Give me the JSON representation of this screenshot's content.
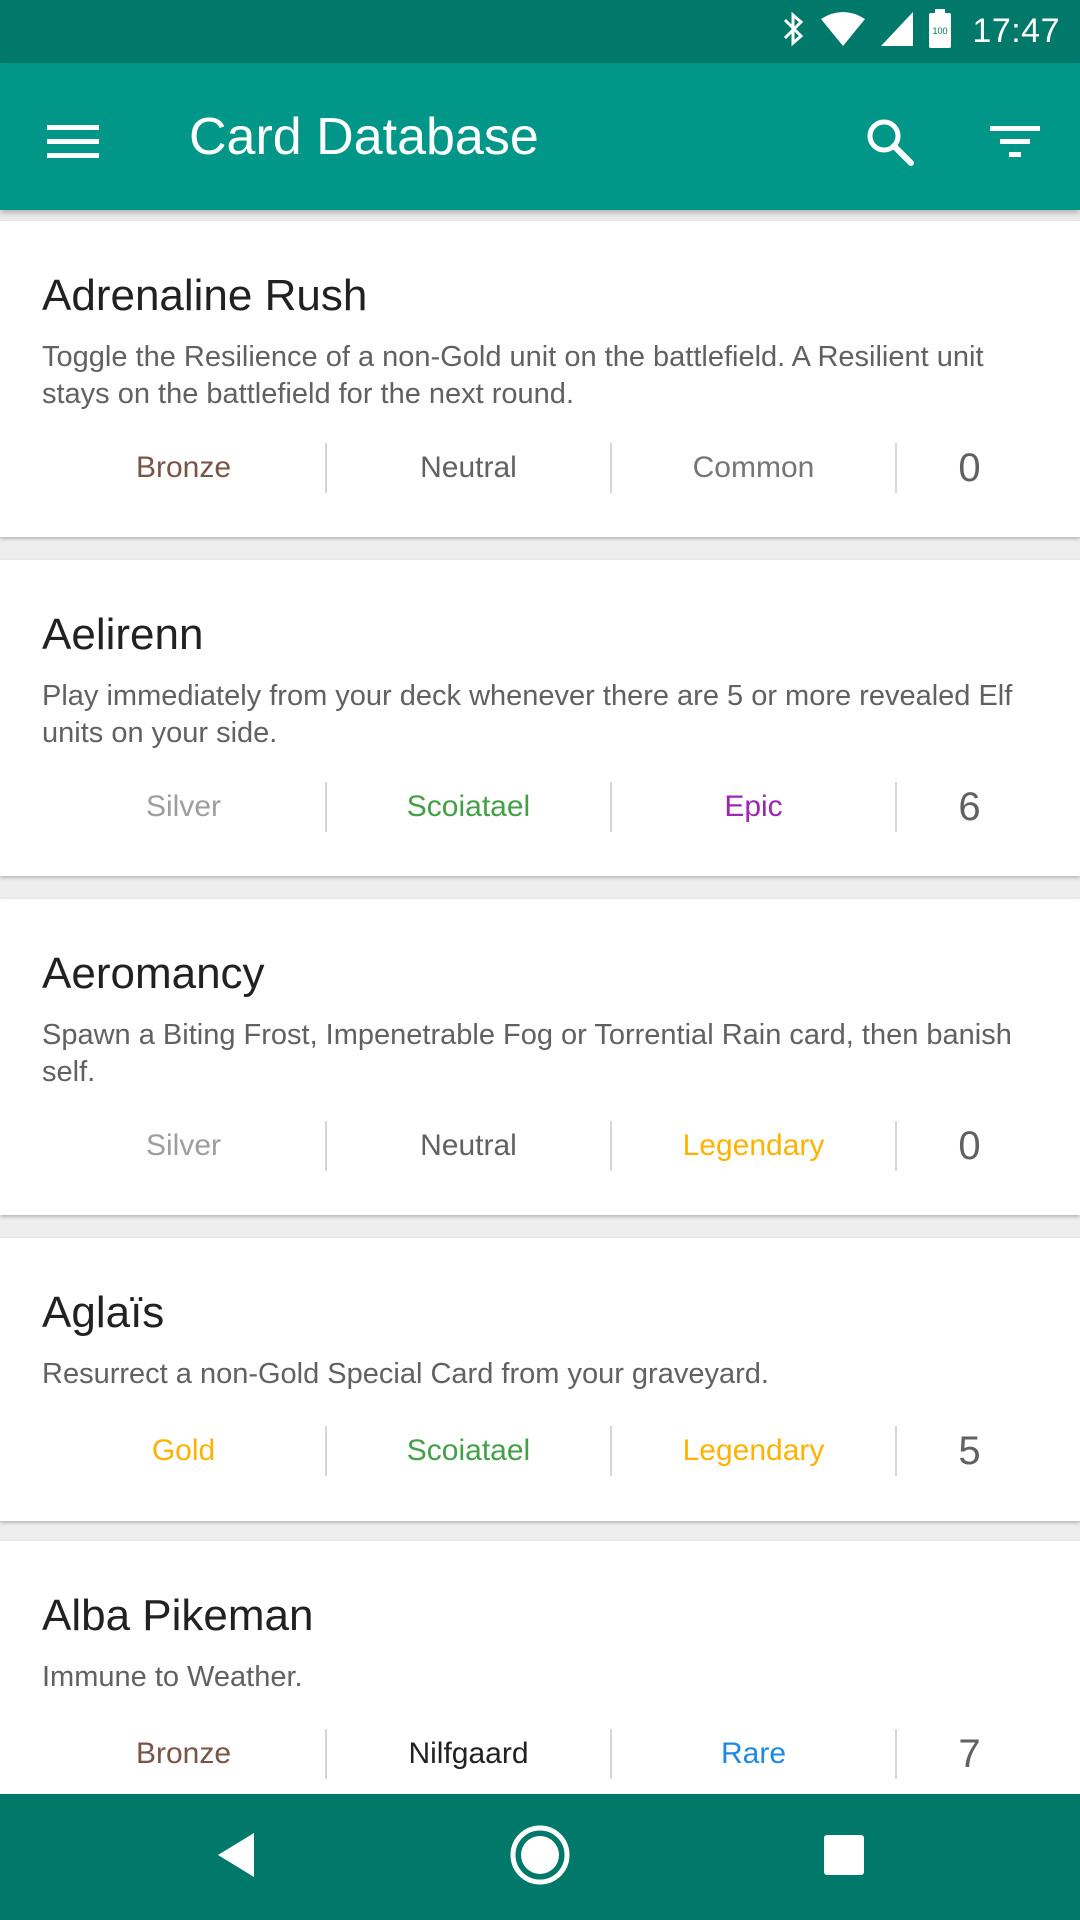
{
  "status_bar": {
    "time": "17:47",
    "battery_level": "100",
    "icons": [
      "bluetooth-icon",
      "wifi-icon",
      "signal-icon",
      "battery-icon"
    ]
  },
  "app_bar": {
    "title": "Card Database",
    "icons": [
      "menu-icon",
      "search-icon",
      "filter-icon"
    ],
    "color": "#009688",
    "status_color": "#00796b"
  },
  "cards": [
    {
      "name": "Adrenaline Rush",
      "description": "Toggle the Resilience of a non-Gold unit on the battlefield. A Resilient unit stays on the battlefield for the next round.",
      "tier": "Bronze",
      "tier_color": "#795548",
      "faction": "Neutral",
      "faction_color": "#616161",
      "rarity": "Common",
      "rarity_color": "#757575",
      "cost": "0"
    },
    {
      "name": "Aelirenn",
      "description": "Play immediately from your deck whenever there are 5 or more revealed Elf units on your side.",
      "tier": "Silver",
      "tier_color": "#9e9e9e",
      "faction": "Scoiatael",
      "faction_color": "#43a047",
      "rarity": "Epic",
      "rarity_color": "#9c27b0",
      "cost": "6"
    },
    {
      "name": "Aeromancy",
      "description": "Spawn a Biting Frost, Impenetrable Fog or Torrential Rain card, then banish self.",
      "tier": "Silver",
      "tier_color": "#9e9e9e",
      "faction": "Neutral",
      "faction_color": "#616161",
      "rarity": "Legendary",
      "rarity_color": "#ffb300",
      "cost": "0"
    },
    {
      "name": "Aglaïs",
      "description": "Resurrect a non-Gold Special Card from your graveyard.",
      "tier": "Gold",
      "tier_color": "#ffb300",
      "faction": "Scoiatael",
      "faction_color": "#43a047",
      "rarity": "Legendary",
      "rarity_color": "#ffb300",
      "cost": "5"
    },
    {
      "name": "Alba Pikeman",
      "description": "Immune to Weather.",
      "tier": "Bronze",
      "tier_color": "#795548",
      "faction": "Nilfgaard",
      "faction_color": "#212121",
      "rarity": "Rare",
      "rarity_color": "#1e88e5",
      "cost": "7"
    }
  ],
  "nav_bar": {
    "icons": [
      "back-icon",
      "home-icon",
      "recents-icon"
    ]
  }
}
